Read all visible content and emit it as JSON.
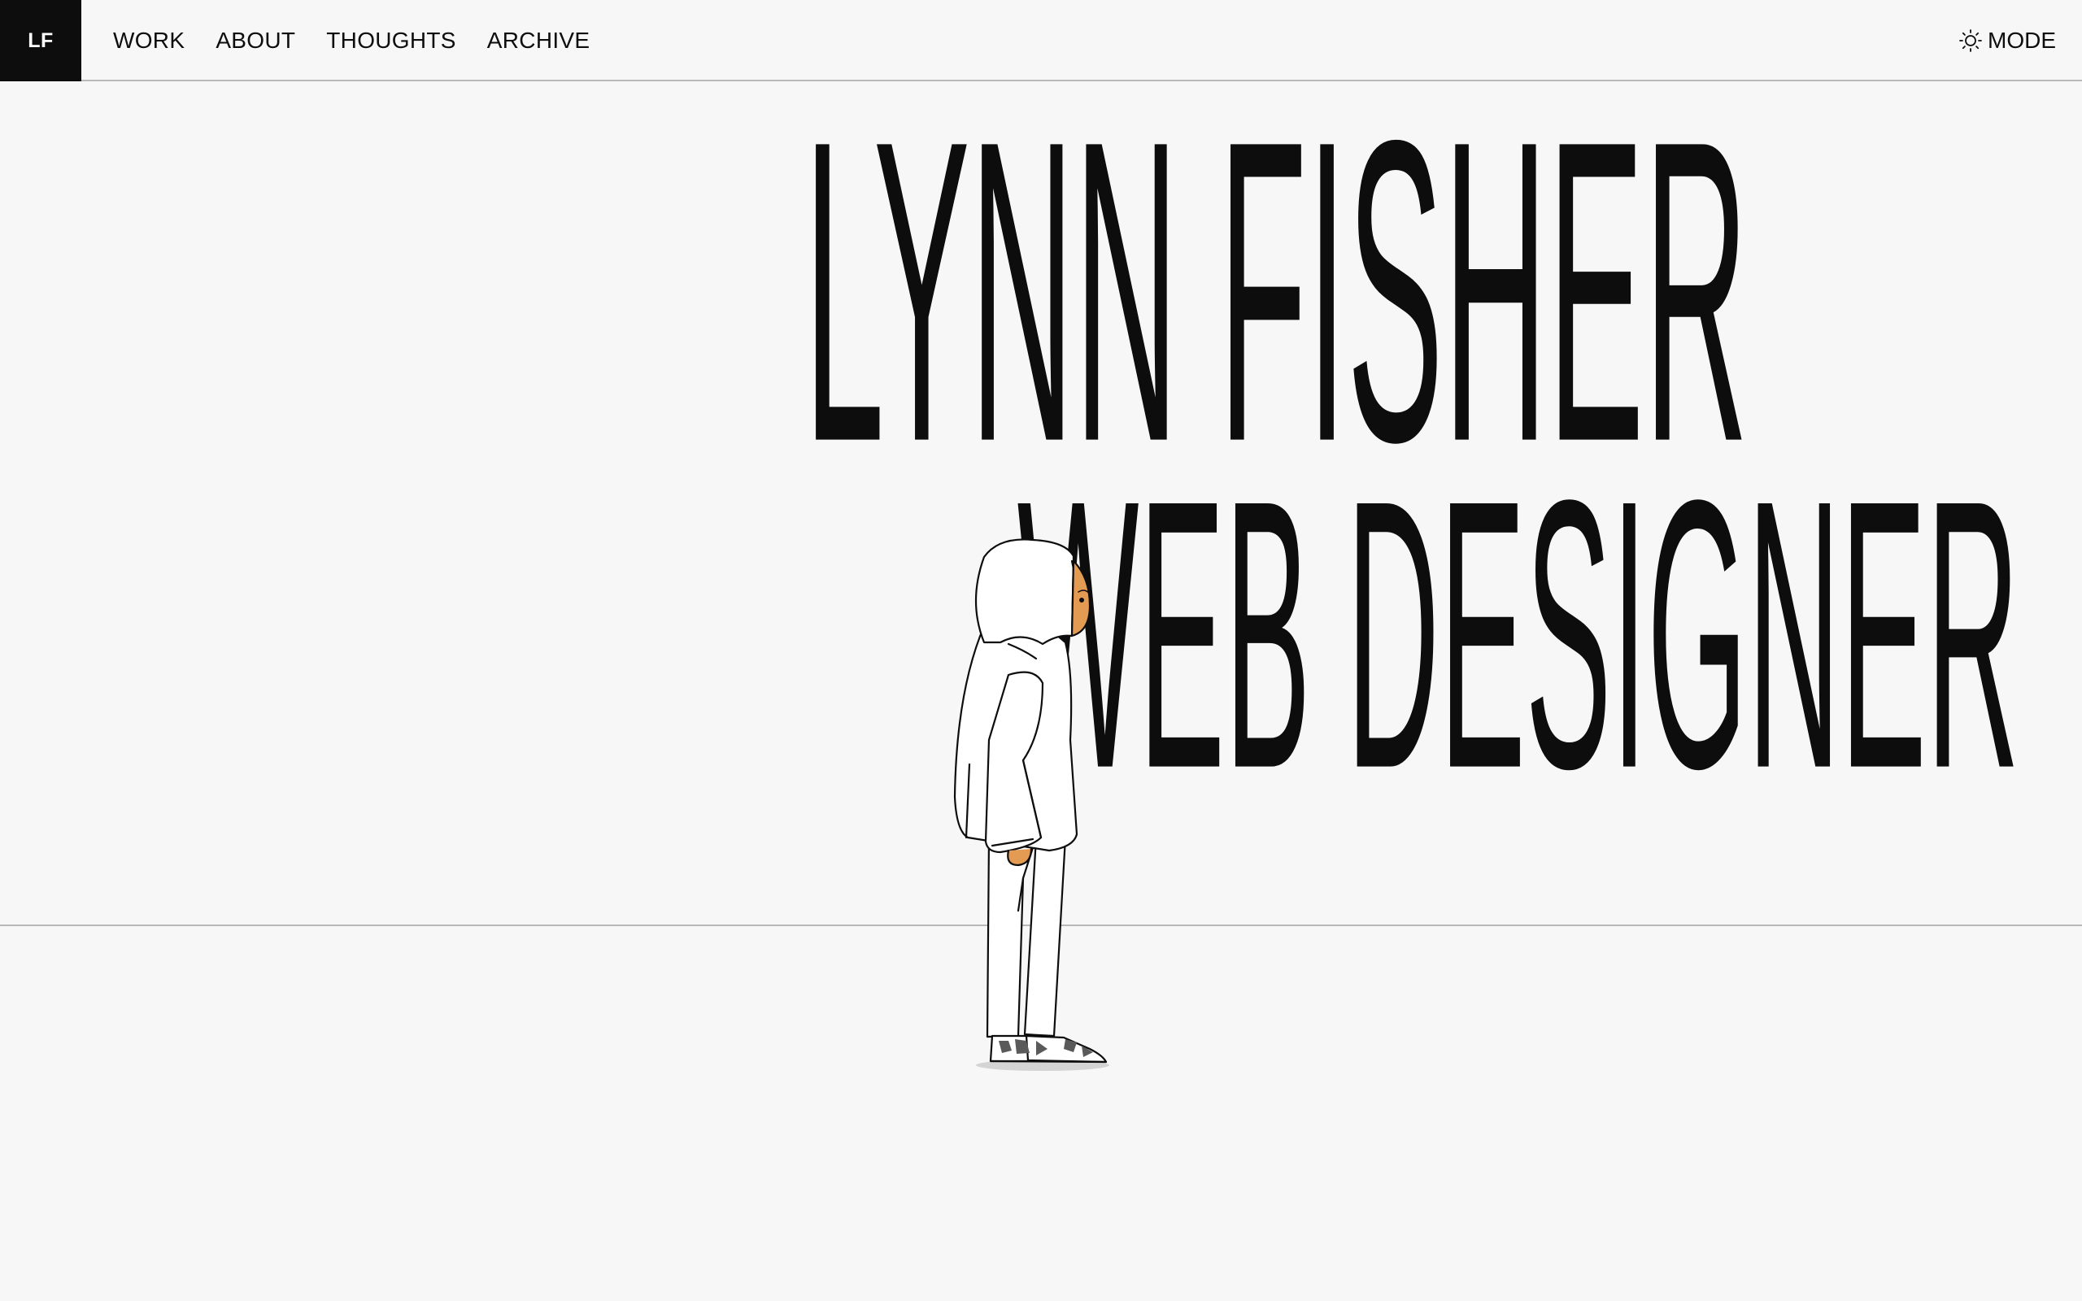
{
  "nav": {
    "logo": "LF",
    "items": [
      {
        "label": "WORK"
      },
      {
        "label": "ABOUT"
      },
      {
        "label": "THOUGHTS"
      },
      {
        "label": "ARCHIVE"
      }
    ],
    "mode_label": "MODE",
    "mode_icon": "sun-icon"
  },
  "hero": {
    "line1": "LYNN FISHER",
    "line2": "WEB DESIGNER"
  },
  "colors": {
    "background": "#f7f7f7",
    "text": "#0d0d0d",
    "skin": "#e39a52",
    "rule": "#b8b8b8"
  }
}
